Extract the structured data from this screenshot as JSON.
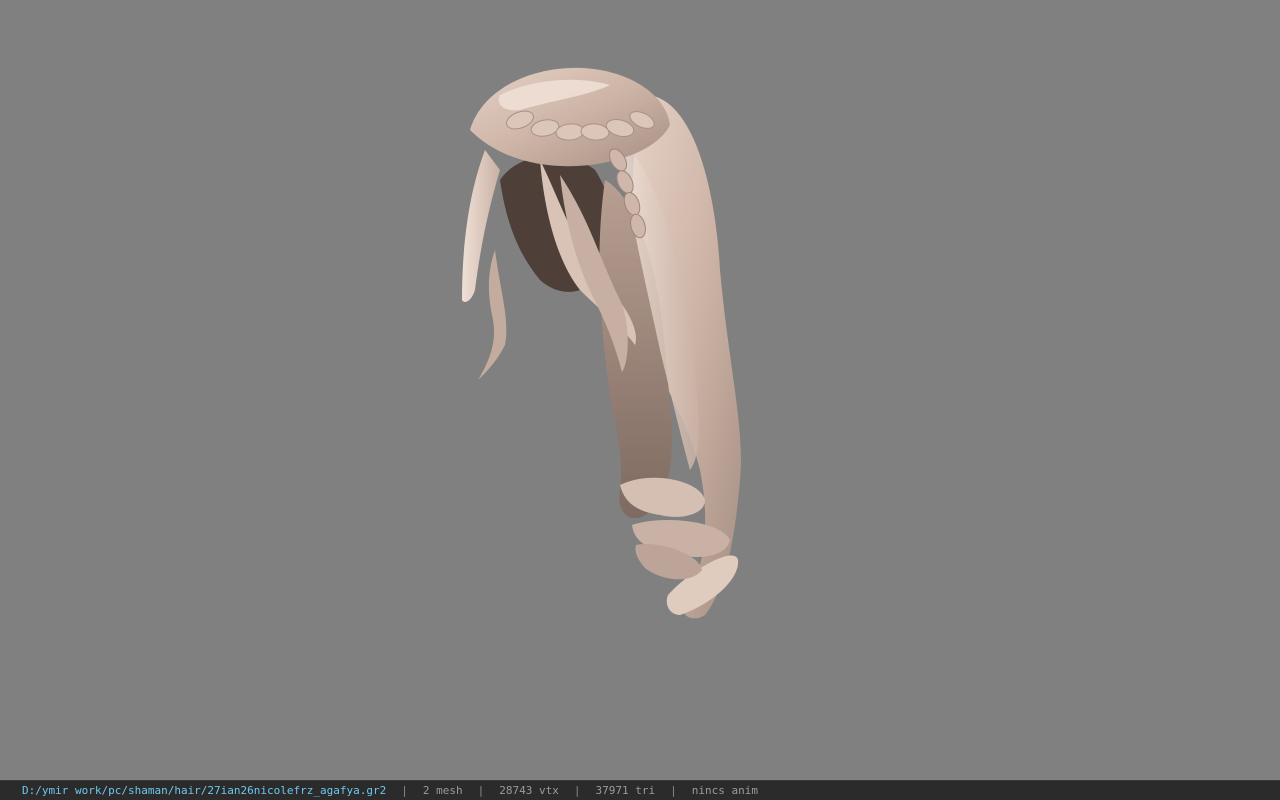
{
  "viewer": {
    "background_color": "#808080",
    "model_icon": "hair-model-icon",
    "hair_color": "#d8c2b6"
  },
  "statusbar": {
    "file_path": "D:/ymir work/pc/shaman/hair/27ian26nicolefrz_agafya.gr2",
    "separator": "|",
    "mesh": "2 mesh",
    "vertices": "28743 vtx",
    "triangles": "37971 tri",
    "animation": "nincs anim"
  }
}
